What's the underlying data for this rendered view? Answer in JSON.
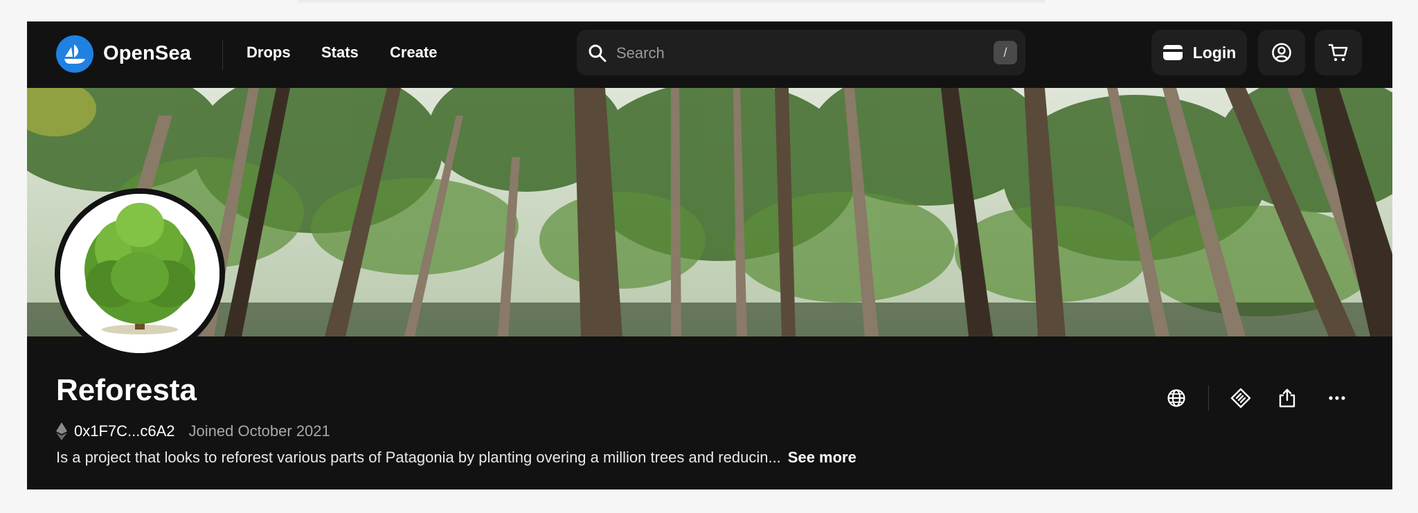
{
  "nav": {
    "brand": "OpenSea",
    "links": [
      "Drops",
      "Stats",
      "Create"
    ],
    "search_placeholder": "Search",
    "search_shortcut": "/",
    "login_label": "Login"
  },
  "collection": {
    "name": "Reforesta",
    "address": "0x1F7C...c6A2",
    "joined": "Joined October 2021",
    "description": "Is a project that looks to reforest various parts of Patagonia by planting overing a million trees and reducin...",
    "see_more": "See more"
  },
  "icons": {
    "logo": "opensea-logo-icon",
    "search": "search-icon",
    "wallet": "wallet-icon",
    "account": "account-icon",
    "cart": "cart-icon",
    "chain": "ethereum-icon",
    "website": "globe-icon",
    "verify": "badge-icon",
    "share": "share-icon",
    "more": "more-icon"
  },
  "colors": {
    "background": "#121212",
    "brand_blue": "#2081e2",
    "search_bg": "#1f1f1f",
    "muted_text": "#a8a8a8"
  }
}
